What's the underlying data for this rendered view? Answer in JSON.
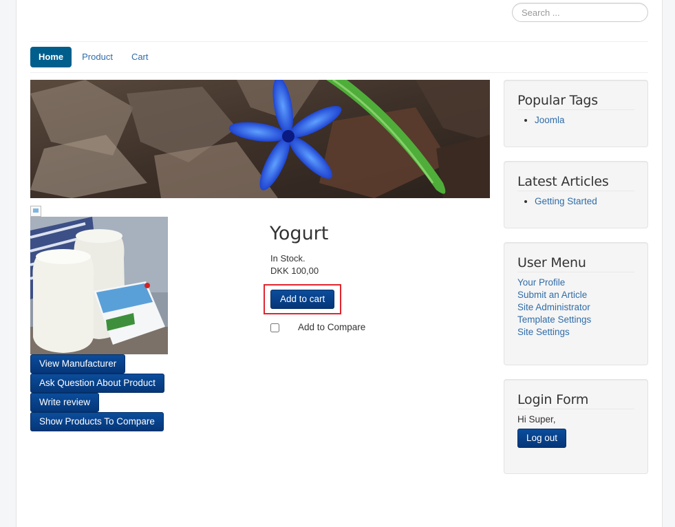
{
  "search": {
    "placeholder": "Search ..."
  },
  "nav": {
    "items": [
      "Home",
      "Product",
      "Cart"
    ]
  },
  "product": {
    "title": "Yogurt",
    "stock": "In Stock.",
    "price": "DKK 100,00",
    "add_to_cart": "Add to cart",
    "compare_label": "Add to Compare",
    "buttons": [
      "View Manufacturer",
      "Ask Question About Product",
      "Write review",
      "Show Products To Compare"
    ]
  },
  "sidebar": {
    "popular_tags": {
      "title": "Popular Tags",
      "items": [
        "Joomla"
      ]
    },
    "latest_articles": {
      "title": "Latest Articles",
      "items": [
        "Getting Started"
      ]
    },
    "user_menu": {
      "title": "User Menu",
      "items": [
        "Your Profile",
        "Submit an Article",
        "Site Administrator",
        "Template Settings",
        "Site Settings"
      ]
    },
    "login_form": {
      "title": "Login Form",
      "greeting": "Hi Super,",
      "logout": "Log out"
    }
  },
  "colors": {
    "nav_active": "#005e8d",
    "button": "#0b4d9c",
    "link": "#2f6ca8",
    "highlight": "#e0242d"
  }
}
